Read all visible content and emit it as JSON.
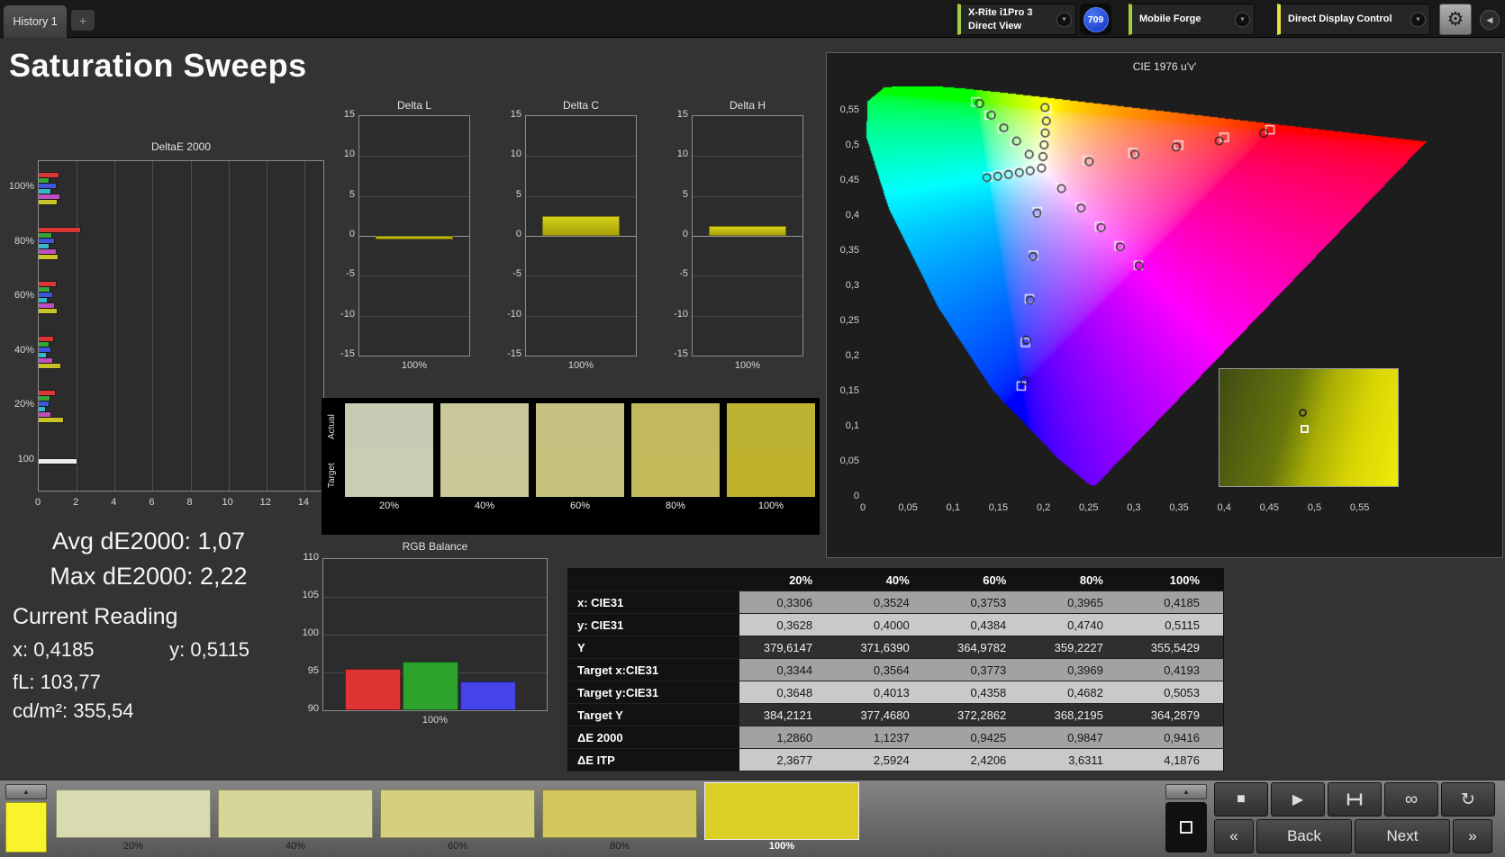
{
  "topbar": {
    "history_tab": "History 1",
    "add_tab": "+",
    "meter": {
      "line1": "X-Rite i1Pro 3",
      "line2": "Direct View"
    },
    "meter_badge": "709",
    "meter_accent": "#a3cf3b",
    "source_label": "Mobile Forge",
    "source_accent": "#a3cf3b",
    "display_label": "Direct Display Control",
    "display_accent": "#e4e437"
  },
  "icons": {
    "chevron_down": "▼",
    "gear": "⚙",
    "collapse_left": "◀",
    "up": "▲",
    "stop": "■",
    "play": "▶",
    "infinity": "∞",
    "refresh": "↻"
  },
  "title": "Saturation Sweeps",
  "stats": {
    "avg": "Avg dE2000: 1,07",
    "max": "Max dE2000: 2,22",
    "current_reading": "Current Reading",
    "x": "x: 0,4185",
    "y": "y: 0,5115",
    "fl": "fL: 103,77",
    "cdm2": "cd/m²: 355,54"
  },
  "swatch_panel": {
    "row_labels": [
      "Actual",
      "Target"
    ],
    "labels": [
      "20%",
      "40%",
      "60%",
      "80%",
      "100%"
    ],
    "actual_colors": [
      "#c8cbb3",
      "#c7c79b",
      "#c5c181",
      "#c2b95f",
      "#beb232"
    ],
    "target_colors": [
      "#cacdb1",
      "#c8c898",
      "#c6c27e",
      "#c3ba5b",
      "#bfb22c"
    ]
  },
  "table": {
    "headers": [
      "20%",
      "40%",
      "60%",
      "80%",
      "100%"
    ],
    "rows": [
      {
        "label": "x: CIE31",
        "values": [
          "0,3306",
          "0,3524",
          "0,3753",
          "0,3965",
          "0,4185"
        ]
      },
      {
        "label": "y: CIE31",
        "values": [
          "0,3628",
          "0,4000",
          "0,4384",
          "0,4740",
          "0,5115"
        ]
      },
      {
        "label": "Y",
        "values": [
          "379,6147",
          "371,6390",
          "364,9782",
          "359,2227",
          "355,5429"
        ]
      },
      {
        "label": "Target x:CIE31",
        "values": [
          "0,3344",
          "0,3564",
          "0,3773",
          "0,3969",
          "0,4193"
        ]
      },
      {
        "label": "Target y:CIE31",
        "values": [
          "0,3648",
          "0,4013",
          "0,4358",
          "0,4682",
          "0,5053"
        ]
      },
      {
        "label": "Target Y",
        "values": [
          "384,2121",
          "377,4680",
          "372,2862",
          "368,2195",
          "364,2879"
        ]
      },
      {
        "label": "ΔE 2000",
        "values": [
          "1,2860",
          "1,1237",
          "0,9425",
          "0,9847",
          "0,9416"
        ]
      },
      {
        "label": "ΔE ITP",
        "values": [
          "2,3677",
          "2,5924",
          "2,4206",
          "3,6311",
          "4,1876"
        ]
      }
    ]
  },
  "footer": {
    "patches": [
      {
        "label": "20%",
        "color": "#d8dab0"
      },
      {
        "label": "40%",
        "color": "#d6d698"
      },
      {
        "label": "60%",
        "color": "#d4d07e"
      },
      {
        "label": "80%",
        "color": "#d2c75e"
      },
      {
        "label": "100%",
        "color": "#dcce24"
      }
    ],
    "active_patch": 4,
    "current_color": "#f9f32b",
    "prev_chevron": "«",
    "back_label": "Back",
    "next_label": "Next",
    "next_chevron": "»"
  },
  "chart_data": [
    {
      "id": "deltae2000",
      "type": "bar",
      "orientation": "horizontal",
      "title": "DeltaE 2000",
      "xlim": [
        0,
        15
      ],
      "xticks": [
        0,
        2,
        4,
        6,
        8,
        10,
        12,
        14
      ],
      "groups": [
        {
          "label": "100%",
          "bars": [
            {
              "c": "#d93636",
              "v": 1.05
            },
            {
              "c": "#36a336",
              "v": 0.5
            },
            {
              "c": "#3d55d9",
              "v": 0.9
            },
            {
              "c": "#2fb9c9",
              "v": 0.6
            },
            {
              "c": "#c04ec0",
              "v": 1.1
            },
            {
              "c": "#c9c327",
              "v": 0.94
            }
          ]
        },
        {
          "label": "80%",
          "bars": [
            {
              "c": "#d93636",
              "v": 2.2
            },
            {
              "c": "#36a336",
              "v": 0.65
            },
            {
              "c": "#3d55d9",
              "v": 0.8
            },
            {
              "c": "#2fb9c9",
              "v": 0.5
            },
            {
              "c": "#c04ec0",
              "v": 0.9
            },
            {
              "c": "#c9c327",
              "v": 0.98
            }
          ]
        },
        {
          "label": "60%",
          "bars": [
            {
              "c": "#d93636",
              "v": 0.9
            },
            {
              "c": "#36a336",
              "v": 0.55
            },
            {
              "c": "#3d55d9",
              "v": 0.7
            },
            {
              "c": "#2fb9c9",
              "v": 0.45
            },
            {
              "c": "#c04ec0",
              "v": 0.8
            },
            {
              "c": "#c9c327",
              "v": 0.94
            }
          ]
        },
        {
          "label": "40%",
          "bars": [
            {
              "c": "#d93636",
              "v": 0.75
            },
            {
              "c": "#36a336",
              "v": 0.5
            },
            {
              "c": "#3d55d9",
              "v": 0.6
            },
            {
              "c": "#2fb9c9",
              "v": 0.4
            },
            {
              "c": "#c04ec0",
              "v": 0.7
            },
            {
              "c": "#c9c327",
              "v": 1.12
            }
          ]
        },
        {
          "label": "20%",
          "bars": [
            {
              "c": "#d93636",
              "v": 0.85
            },
            {
              "c": "#36a336",
              "v": 0.55
            },
            {
              "c": "#3d55d9",
              "v": 0.5
            },
            {
              "c": "#2fb9c9",
              "v": 0.35
            },
            {
              "c": "#c04ec0",
              "v": 0.6
            },
            {
              "c": "#c9c327",
              "v": 1.29
            }
          ]
        },
        {
          "label": "100",
          "bars": [
            {
              "c": "#ececec",
              "v": 2.0
            }
          ]
        }
      ]
    },
    {
      "id": "delta_l",
      "type": "bar",
      "title": "Delta L",
      "ylim": [
        -15,
        15
      ],
      "yticks": [
        15,
        10,
        5,
        0,
        -5,
        -10,
        -15
      ],
      "categories": [
        "100%"
      ],
      "values": [
        -0.5
      ]
    },
    {
      "id": "delta_c",
      "type": "bar",
      "title": "Delta C",
      "ylim": [
        -15,
        15
      ],
      "yticks": [
        15,
        10,
        5,
        0,
        -5,
        -10,
        -15
      ],
      "categories": [
        "100%"
      ],
      "values": [
        2.5
      ]
    },
    {
      "id": "delta_h",
      "type": "bar",
      "title": "Delta H",
      "ylim": [
        -15,
        15
      ],
      "yticks": [
        15,
        10,
        5,
        0,
        -5,
        -10,
        -15
      ],
      "categories": [
        "100%"
      ],
      "values": [
        1.2
      ]
    },
    {
      "id": "rgb_balance",
      "type": "bar",
      "title": "RGB Balance",
      "ylim": [
        90,
        110
      ],
      "yticks": [
        110,
        105,
        100,
        95,
        90
      ],
      "categories": [
        "100%"
      ],
      "series": [
        {
          "name": "Red",
          "color": "#e03434",
          "value": 95.5
        },
        {
          "name": "Green",
          "color": "#2da32d",
          "value": 96.4
        },
        {
          "name": "Blue",
          "color": "#4444e8",
          "value": 93.8
        }
      ]
    },
    {
      "id": "cie",
      "type": "scatter",
      "title": "CIE 1976 u'v'",
      "tick_step": 0.05,
      "x_ticks": [
        "0",
        "0,05",
        "0,1",
        "0,15",
        "0,2",
        "0,25",
        "0,3",
        "0,35",
        "0,4",
        "0,45",
        "0,5",
        "0,55"
      ],
      "y_ticks": [
        "0,55",
        "0,5",
        "0,45",
        "0,4",
        "0,35",
        "0,3",
        "0,25",
        "0,2",
        "0,15",
        "0,1",
        "0,05",
        "0"
      ],
      "white_point": [
        0.1978,
        0.4683
      ],
      "sweeps": [
        {
          "name": "red",
          "target": [
            [
              0.2484,
              0.4792
            ],
            [
              0.299,
              0.4901
            ],
            [
              0.3495,
              0.5011
            ],
            [
              0.4001,
              0.512
            ],
            [
              0.4507,
              0.5229
            ]
          ],
          "measured": [
            [
              0.2505,
              0.4775
            ],
            [
              0.3012,
              0.4878
            ],
            [
              0.347,
              0.4985
            ],
            [
              0.3945,
              0.507
            ],
            [
              0.4438,
              0.518
            ]
          ]
        },
        {
          "name": "green",
          "target": [
            [
              0.1832,
              0.4871
            ],
            [
              0.1687,
              0.506
            ],
            [
              0.1541,
              0.5248
            ],
            [
              0.1396,
              0.5437
            ],
            [
              0.125,
              0.5625
            ]
          ],
          "measured": [
            [
              0.1841,
              0.4878
            ],
            [
              0.1702,
              0.5068
            ],
            [
              0.156,
              0.5255
            ],
            [
              0.1422,
              0.5436
            ],
            [
              0.1293,
              0.5602
            ]
          ]
        },
        {
          "name": "blue",
          "target": [
            [
              0.1933,
              0.4062
            ],
            [
              0.1888,
              0.3441
            ],
            [
              0.1844,
              0.2821
            ],
            [
              0.1799,
              0.22
            ],
            [
              0.1754,
              0.1579
            ]
          ],
          "measured": [
            [
              0.1929,
              0.4041
            ],
            [
              0.1884,
              0.3425
            ],
            [
              0.1852,
              0.2803
            ],
            [
              0.1812,
              0.2235
            ],
            [
              0.1794,
              0.1652
            ]
          ]
        },
        {
          "name": "cyan",
          "target": [
            [
              0.1859,
              0.4658
            ],
            [
              0.1741,
              0.4633
            ],
            [
              0.1622,
              0.4607
            ],
            [
              0.1504,
              0.4582
            ],
            [
              0.1385,
              0.4557
            ]
          ],
          "measured": [
            [
              0.1852,
              0.4645
            ],
            [
              0.1733,
              0.4618
            ],
            [
              0.1613,
              0.4592
            ],
            [
              0.1494,
              0.4568
            ],
            [
              0.1374,
              0.4547
            ]
          ]
        },
        {
          "name": "magenta",
          "target": [
            [
              0.2192,
              0.4406
            ],
            [
              0.2407,
              0.4129
            ],
            [
              0.2621,
              0.3852
            ],
            [
              0.2836,
              0.3575
            ],
            [
              0.305,
              0.3298
            ]
          ],
          "measured": [
            [
              0.2199,
              0.4392
            ],
            [
              0.2416,
              0.4114
            ],
            [
              0.2637,
              0.3836
            ],
            [
              0.2849,
              0.3562
            ],
            [
              0.3058,
              0.3291
            ]
          ]
        },
        {
          "name": "yellow",
          "target": [
            [
              0.199,
              0.4852
            ],
            [
              0.2002,
              0.5021
            ],
            [
              0.2015,
              0.519
            ],
            [
              0.2027,
              0.5359
            ],
            [
              0.2039,
              0.5528
            ]
          ],
          "measured": [
            [
              0.1994,
              0.4846
            ],
            [
              0.2007,
              0.5012
            ],
            [
              0.2019,
              0.5183
            ],
            [
              0.2031,
              0.5352
            ],
            [
              0.2017,
              0.5546
            ]
          ]
        }
      ]
    }
  ]
}
